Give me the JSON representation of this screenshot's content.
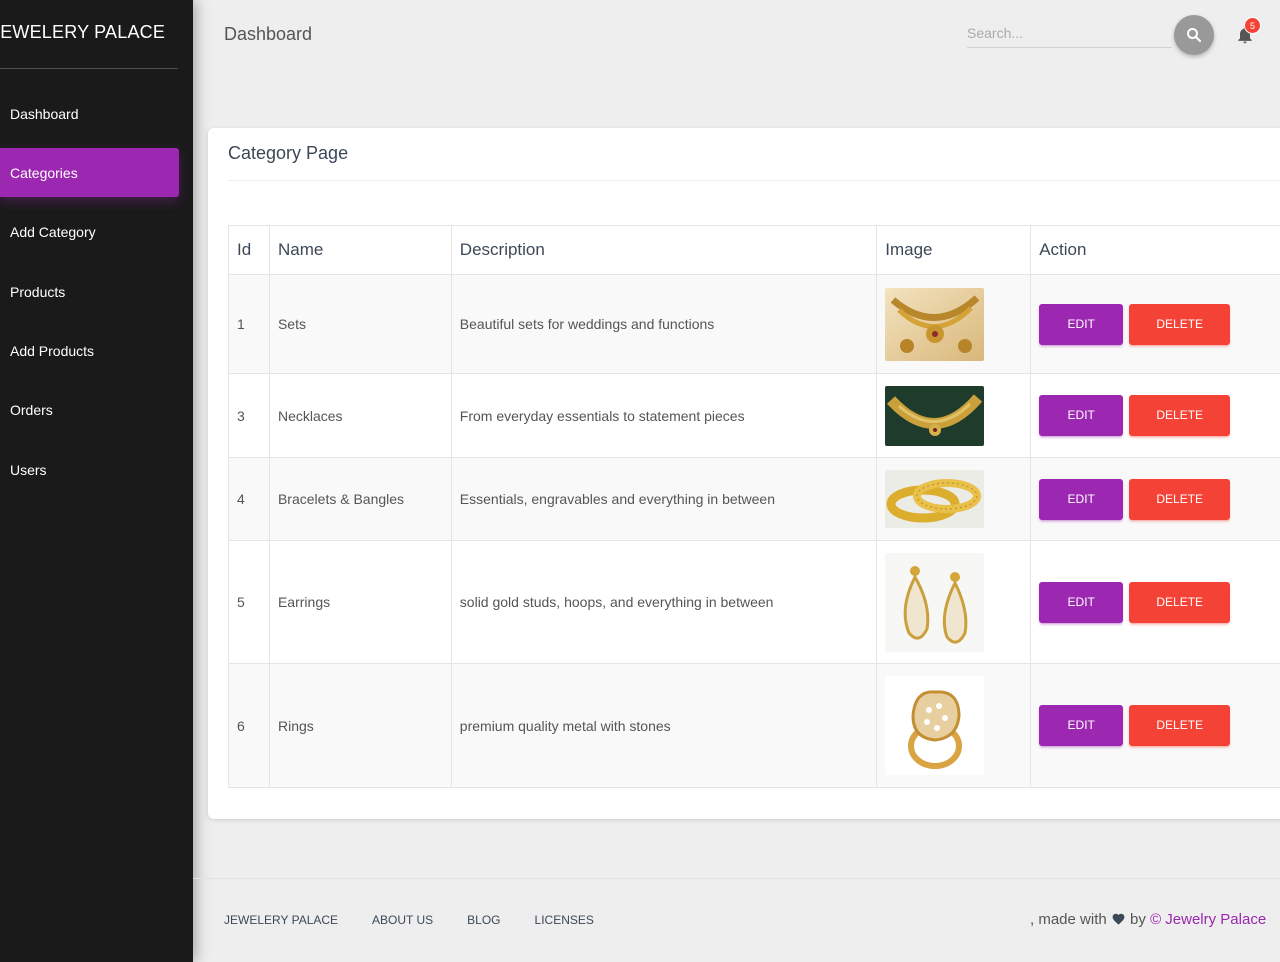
{
  "sidebar": {
    "brand": "JEWELERY PALACE",
    "items": [
      {
        "label": "Dashboard"
      },
      {
        "label": "Categories"
      },
      {
        "label": "Add Category"
      },
      {
        "label": "Products"
      },
      {
        "label": "Add Products"
      },
      {
        "label": "Orders"
      },
      {
        "label": "Users"
      }
    ]
  },
  "topbar": {
    "title": "Dashboard",
    "search_placeholder": "Search...",
    "notification_count": "5"
  },
  "card": {
    "title": "Category Page",
    "headers": {
      "id": "Id",
      "name": "Name",
      "description": "Description",
      "image": "Image",
      "action": "Action"
    },
    "edit_label": "EDIT",
    "delete_label": "DELETE",
    "rows": [
      {
        "id": "1",
        "name": "Sets",
        "description": "Beautiful sets for weddings and functions",
        "image": "gold-jewelry-set"
      },
      {
        "id": "3",
        "name": "Necklaces",
        "description": "From everyday essentials to statement pieces",
        "image": "gold-choker-necklace"
      },
      {
        "id": "4",
        "name": "Bracelets & Bangles",
        "description": "Essentials, engravables and everything in between",
        "image": "gold-bangles"
      },
      {
        "id": "5",
        "name": "Earrings",
        "description": "solid gold studs, hoops, and everything in between",
        "image": "gold-drop-earrings"
      },
      {
        "id": "6",
        "name": "Rings",
        "description": "premium quality metal with stones",
        "image": "gold-stone-ring"
      }
    ]
  },
  "footer": {
    "links": [
      "JEWELERY PALACE",
      "ABOUT US",
      "BLOG",
      "LICENSES"
    ],
    "made_with": ", made with",
    "by": "by",
    "company": "© Jewelry Palace"
  },
  "colors": {
    "primary": "#9c27b0",
    "danger": "#f44336",
    "sidebar_bg": "#1a1a1a",
    "heart": "#3c4858"
  }
}
